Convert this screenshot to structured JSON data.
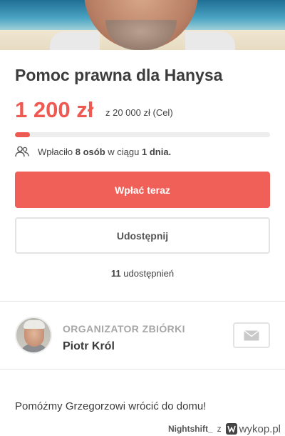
{
  "campaign": {
    "title": "Pomoc prawna dla Hanysa",
    "raised": "1 200 zł",
    "goal": "z 20 000 zł (Cel)",
    "progress_fraction": 0.06
  },
  "donors": {
    "prefix": "Wpłaciło",
    "count": "8 osób",
    "middle": "w ciągu",
    "days": "1 dnia.",
    "icon": "people-icon"
  },
  "actions": {
    "pay_label": "Wpłać teraz",
    "share_label": "Udostępnij"
  },
  "shares": {
    "count": "11",
    "label": "udostępnień"
  },
  "organizer": {
    "label": "ORGANIZATOR ZBIÓRKI",
    "name": "Piotr Król",
    "message_icon": "envelope-icon"
  },
  "description": "Pomóżmy Grzegorzowi wrócić do domu!",
  "footer": {
    "user": "Nightshift_",
    "sep": "z",
    "site": "wykop.pl"
  },
  "colors": {
    "accent": "#f05f58",
    "text": "#3c3c3c",
    "muted": "#a6a6a6"
  }
}
